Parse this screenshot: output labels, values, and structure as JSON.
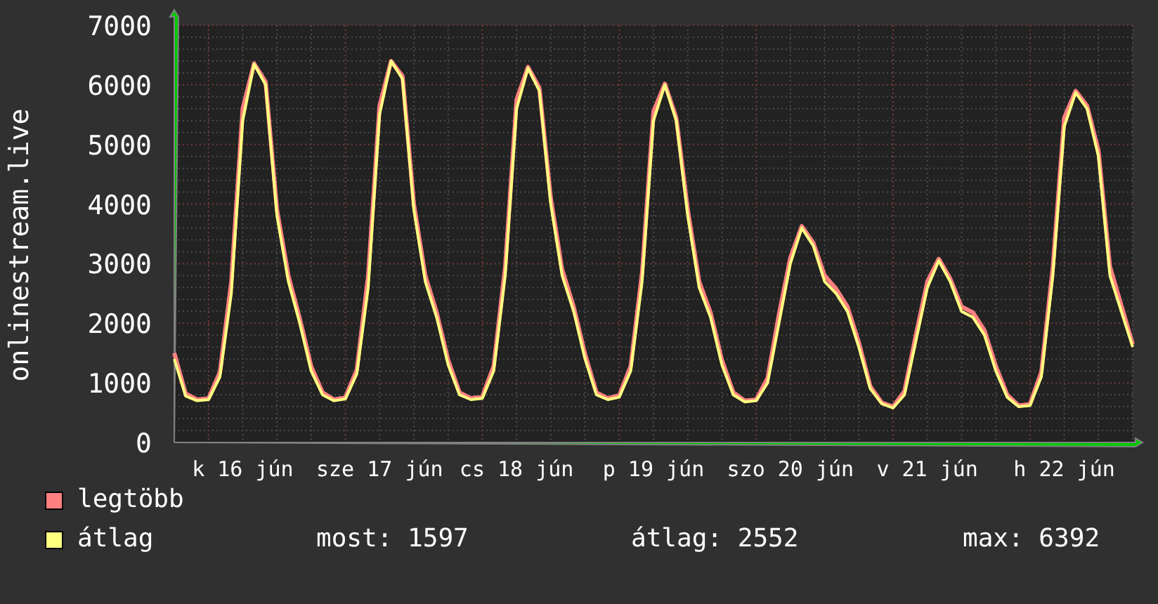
{
  "chart": {
    "chart_data": {
      "type": "line",
      "ylabel": "onlinestream.live",
      "categories": [
        null,
        null,
        null,
        null,
        null,
        null,
        "k 16 jún",
        null,
        null,
        null,
        null,
        null,
        null,
        null,
        null,
        null,
        null,
        null,
        "sze 17 jún",
        null,
        null,
        null,
        null,
        null,
        null,
        null,
        null,
        null,
        null,
        null,
        "cs 18 jún",
        null,
        null,
        null,
        null,
        null,
        null,
        null,
        null,
        null,
        null,
        null,
        "p 19 jún",
        null,
        null,
        null,
        null,
        null,
        null,
        null,
        null,
        null,
        null,
        null,
        "szo 20 jún",
        null,
        null,
        null,
        null,
        null,
        null,
        null,
        null,
        null,
        null,
        null,
        "v 21 jún",
        null,
        null,
        null,
        null,
        null,
        null,
        null,
        null,
        null,
        null,
        null,
        "h 22 jún",
        null,
        null,
        null,
        null,
        null,
        null
      ],
      "series": [
        {
          "name": "legtöbb",
          "color": "#ff8080",
          "values": [
            1500,
            820,
            720,
            740,
            1180,
            2700,
            5600,
            6360,
            6050,
            3900,
            2800,
            2080,
            1280,
            840,
            720,
            760,
            1220,
            2800,
            5650,
            6400,
            6150,
            4000,
            2800,
            2180,
            1380,
            840,
            740,
            770,
            1280,
            2950,
            5750,
            6300,
            5950,
            4100,
            2900,
            2280,
            1480,
            840,
            740,
            790,
            1280,
            2850,
            5550,
            6020,
            5450,
            3900,
            2700,
            2180,
            1380,
            840,
            700,
            720,
            1080,
            2150,
            3100,
            3630,
            3350,
            2800,
            2580,
            2280,
            1680,
            940,
            670,
            600,
            860,
            1800,
            2700,
            3080,
            2750,
            2280,
            2180,
            1880,
            1280,
            800,
            620,
            640,
            1180,
            2950,
            5450,
            5900,
            5650,
            4900,
            2950,
            2300,
            1650
          ]
        },
        {
          "name": "átlag",
          "color": "#ffff80",
          "values": [
            1400,
            780,
            700,
            720,
            1100,
            2500,
            5400,
            6350,
            6000,
            3800,
            2700,
            2000,
            1200,
            800,
            700,
            730,
            1150,
            2600,
            5500,
            6400,
            6100,
            3900,
            2700,
            2100,
            1300,
            800,
            720,
            740,
            1200,
            2800,
            5600,
            6280,
            5900,
            4000,
            2800,
            2200,
            1400,
            800,
            720,
            760,
            1200,
            2700,
            5400,
            6000,
            5400,
            3800,
            2600,
            2100,
            1300,
            800,
            680,
            700,
            1000,
            2000,
            3000,
            3600,
            3300,
            2700,
            2500,
            2200,
            1600,
            900,
            650,
            580,
            800,
            1700,
            2600,
            3050,
            2700,
            2200,
            2100,
            1800,
            1200,
            760,
            600,
            620,
            1100,
            2800,
            5300,
            5870,
            5600,
            4800,
            2800,
            2200,
            1600
          ]
        }
      ],
      "grid": true,
      "ylim": [
        0,
        7000
      ],
      "yticks": [
        0,
        1000,
        2000,
        3000,
        4000,
        5000,
        6000,
        7000
      ]
    }
  },
  "legend": {
    "stats": [
      "most: 1597",
      "átlag: 2552",
      "max: 6392"
    ]
  }
}
